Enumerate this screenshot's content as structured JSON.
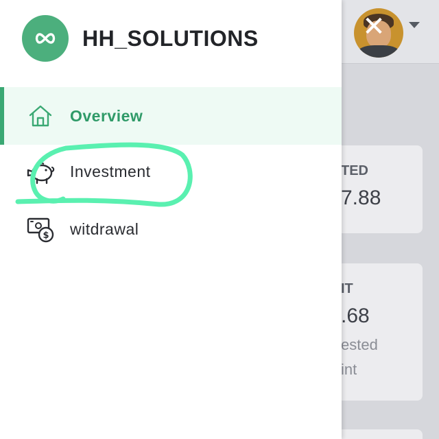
{
  "header": {
    "avatar_icon": "user-avatar",
    "close_icon": "close-icon",
    "dropdown_icon": "chevron-down-icon"
  },
  "background_cards": [
    {
      "title": "TED",
      "value": "7.88"
    },
    {
      "title": "IT",
      "value": ".68",
      "sub_line1": "ested",
      "sub_line2": "int"
    }
  ],
  "drawer": {
    "brand": {
      "name": "HH_SOLUTIONS",
      "logo_icon": "infinity-icon",
      "color": "#4caf7d"
    },
    "nav_items": [
      {
        "label": "Overview",
        "icon": "home-icon",
        "active": true
      },
      {
        "label": "Investment",
        "icon": "piggy-bank-icon",
        "active": false
      },
      {
        "label": "witdrawal",
        "icon": "cash-withdrawal-icon",
        "active": false
      }
    ],
    "accent_color": "#3aa873",
    "annotation_color": "#5af0b0"
  }
}
